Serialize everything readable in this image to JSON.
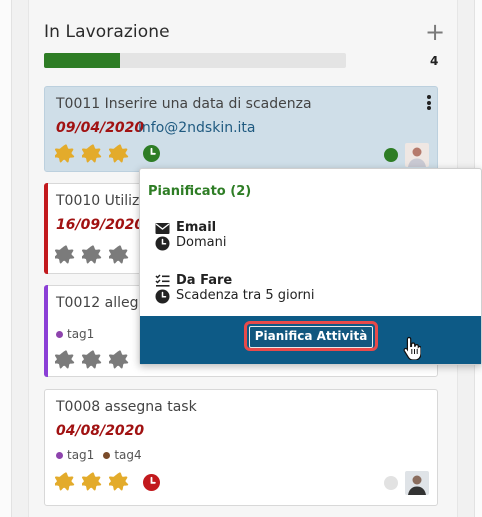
{
  "column": {
    "title": "In Lavorazione",
    "add_icon": "plus-icon",
    "count": "4",
    "progress_fraction": 0.25,
    "progress_color": "#2e7d25"
  },
  "cards": [
    {
      "code_title": "T0011 Inserire una data di scadenza",
      "date": "09/04/2020",
      "email": "info@2ndskin.ita",
      "stars": 3,
      "star_color": "#e3ab2b",
      "clock_color": "#2e7d25",
      "status_dot_color": "#2e7d25",
      "menu_icon": "kebab-menu-icon"
    },
    {
      "code_title": "T0010 Utilizz",
      "date": "16/09/2020",
      "stars": 0,
      "accent_color": "#c2191d"
    },
    {
      "code_title": "T0012 allega",
      "tags": [
        {
          "label": "tag1",
          "color": "#8e44ad"
        }
      ],
      "stars": 0,
      "accent_color": "#8b3fd6"
    },
    {
      "code_title": "T0008 assegna task",
      "date": "04/08/2020",
      "tags": [
        {
          "label": "tag1",
          "color": "#8e44ad"
        },
        {
          "label": "tag4",
          "color": "#7a4b2a"
        }
      ],
      "stars": 3,
      "star_color": "#e3ab2b",
      "clock_color": "#c2191d",
      "status_dot_color": "#e2e2e2"
    }
  ],
  "popover": {
    "title": "Pianificato (2)",
    "items": [
      {
        "icon": "envelope-icon",
        "title": "Email",
        "sub_icon": "clock-icon",
        "subtitle": "Domani"
      },
      {
        "icon": "checklist-icon",
        "title": "Da Fare",
        "sub_icon": "clock-icon",
        "subtitle": "Scadenza tra 5 giorni"
      }
    ],
    "action_label": "Pianifica Attività",
    "footer_color": "#0d5a86",
    "highlight_color": "#e84a4a"
  }
}
